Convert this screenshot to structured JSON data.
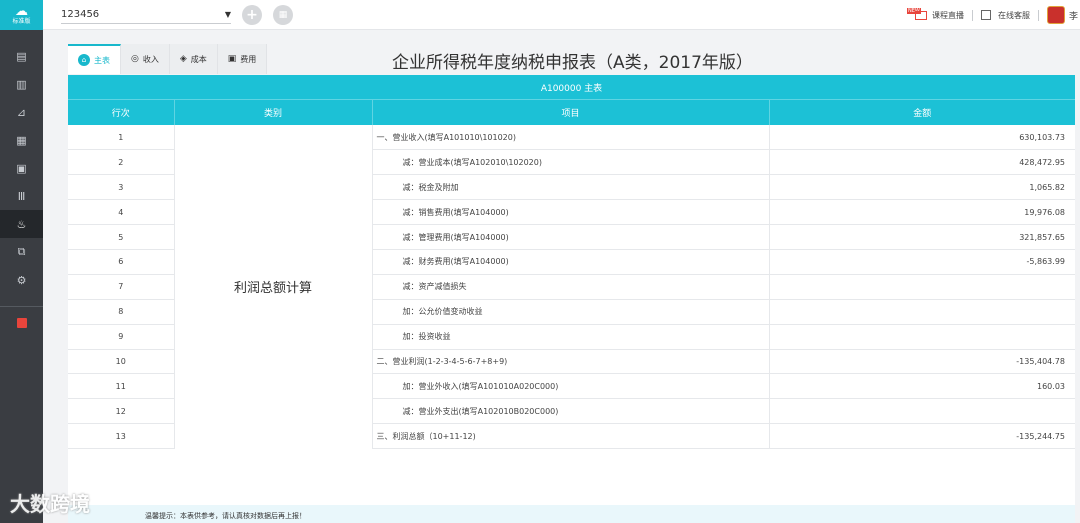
{
  "brand": {
    "edition": "标准版"
  },
  "topbar": {
    "company": "123456",
    "live_tag": "NEW",
    "live_label": "课程直播",
    "service_label": "在线客服",
    "user_name": "李"
  },
  "tabs": [
    {
      "label": "主表",
      "icon": "home-icon",
      "active": true
    },
    {
      "label": "收入",
      "icon": "eye-icon",
      "active": false
    },
    {
      "label": "成本",
      "icon": "layers-icon",
      "active": false
    },
    {
      "label": "费用",
      "icon": "document-icon",
      "active": false
    }
  ],
  "page_title": "企业所得税年度纳税申报表（A类，2017年版）",
  "table": {
    "caption": "A100000 主表",
    "headers": [
      "行次",
      "类别",
      "项目",
      "金额"
    ],
    "category": "利润总额计算",
    "rows": [
      {
        "no": "1",
        "item": "一、营业收入(填写A101010\\101020)",
        "amount": "630,103.73",
        "indent": false
      },
      {
        "no": "2",
        "item": "减：营业成本(填写A102010\\102020)",
        "amount": "428,472.95",
        "indent": true
      },
      {
        "no": "3",
        "item": "减：税金及附加",
        "amount": "1,065.82",
        "indent": true
      },
      {
        "no": "4",
        "item": "减：销售费用(填写A104000)",
        "amount": "19,976.08",
        "indent": true
      },
      {
        "no": "5",
        "item": "减：管理费用(填写A104000)",
        "amount": "321,857.65",
        "indent": true
      },
      {
        "no": "6",
        "item": "减：财务费用(填写A104000)",
        "amount": "-5,863.99",
        "indent": true
      },
      {
        "no": "7",
        "item": "减：资产减值损失",
        "amount": "",
        "indent": true
      },
      {
        "no": "8",
        "item": "加：公允价值变动收益",
        "amount": "",
        "indent": true
      },
      {
        "no": "9",
        "item": "加：投资收益",
        "amount": "",
        "indent": true
      },
      {
        "no": "10",
        "item": "二、营业利润(1-2-3-4-5-6-7+8+9)",
        "amount": "-135,404.78",
        "indent": false
      },
      {
        "no": "11",
        "item": "加：营业外收入(填写A101010A020C000)",
        "amount": "160.03",
        "indent": true
      },
      {
        "no": "12",
        "item": "减：营业外支出(填写A102010B020C000)",
        "amount": "",
        "indent": true
      },
      {
        "no": "13",
        "item": "三、利润总额（10+11-12)",
        "amount": "-135,244.75",
        "indent": false
      }
    ]
  },
  "footer_note": "温馨提示：本表供参考，请认真核对数据后再上报！",
  "watermark": "大数跨境",
  "colors": {
    "accent": "#1cc1d6",
    "sidebar": "#3a3d42"
  }
}
